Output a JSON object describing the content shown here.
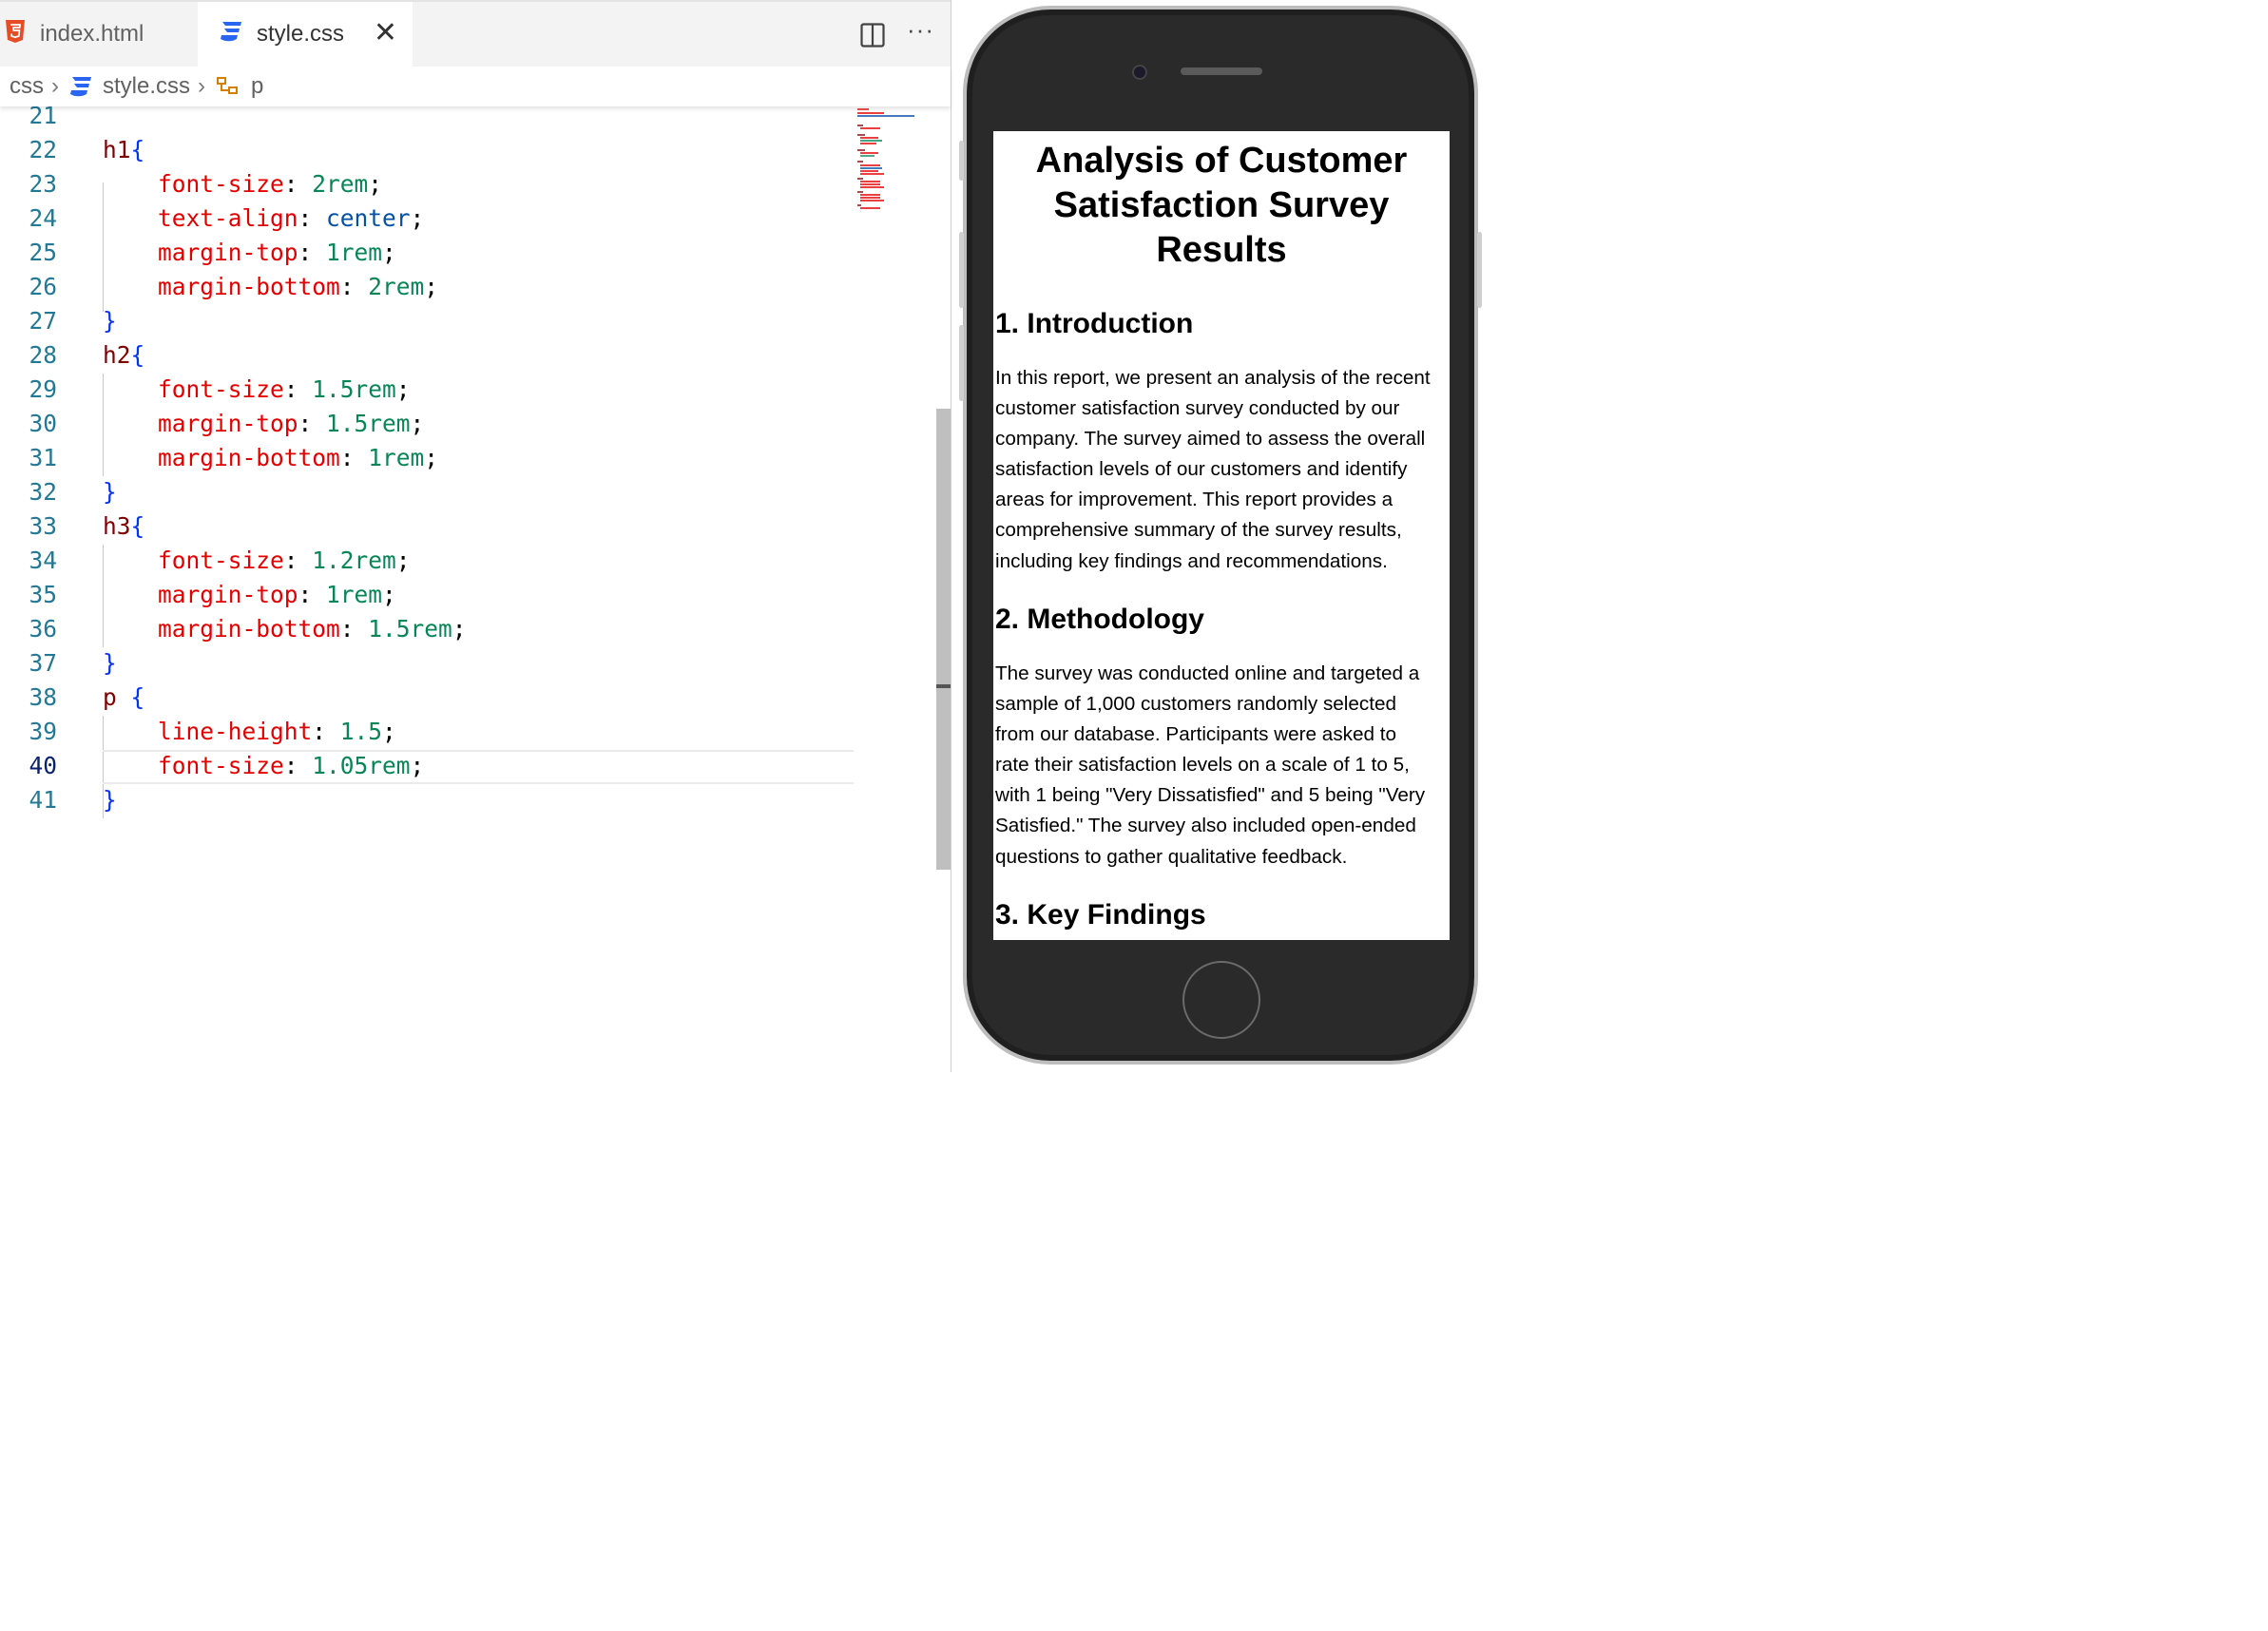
{
  "editor": {
    "tabs": [
      {
        "label": "index.html",
        "icon": "html5-icon"
      },
      {
        "label": "style.css",
        "icon": "css3-icon",
        "active": true
      }
    ],
    "close_glyph": "✕",
    "more_glyph": "···",
    "breadcrumb": [
      "css",
      "style.css",
      "p"
    ],
    "line_numbers": [
      "21",
      "22",
      "23",
      "24",
      "25",
      "26",
      "27",
      "28",
      "29",
      "30",
      "31",
      "32",
      "33",
      "34",
      "35",
      "36",
      "37",
      "38",
      "39",
      "40",
      "41"
    ],
    "active_line": "40",
    "code": {
      "h1_sel": "h1",
      "open": "{",
      "close": "}",
      "h1_fs_prop": "font-size",
      "h1_fs_val": "2rem",
      "h1_ta_prop": "text-align",
      "h1_ta_val": "center",
      "h1_mt_prop": "margin-top",
      "h1_mt_val": "1rem",
      "h1_mb_prop": "margin-bottom",
      "h1_mb_val": "2rem",
      "h2_sel": "h2",
      "h2_fs_prop": "font-size",
      "h2_fs_val": "1.5rem",
      "h2_mt_prop": "margin-top",
      "h2_mt_val": "1.5rem",
      "h2_mb_prop": "margin-bottom",
      "h2_mb_val": "1rem",
      "h3_sel": "h3",
      "h3_fs_prop": "font-size",
      "h3_fs_val": "1.2rem",
      "h3_mt_prop": "margin-top",
      "h3_mt_val": "1rem",
      "h3_mb_prop": "margin-bottom",
      "h3_mb_val": "1.5rem",
      "p_sel": "p",
      "p_lh_prop": "line-height",
      "p_lh_val": "1.5",
      "p_fs_prop": "font-size",
      "p_fs_val": "1.05rem",
      "colon": ": ",
      "semi": ";"
    }
  },
  "preview": {
    "title_lines": [
      "Analysis of Customer",
      "Satisfaction Survey",
      "Results"
    ],
    "sections": [
      {
        "heading": "1. Introduction",
        "lines": [
          "In this report, we present an analysis of the recent",
          "customer satisfaction survey conducted by our",
          "company. The survey aimed to assess the overall",
          "satisfaction levels of our customers and identify",
          "areas for improvement. This report provides a",
          "comprehensive summary of the survey results,",
          "including key findings and recommendations."
        ]
      },
      {
        "heading": "2. Methodology",
        "lines": [
          "The survey was conducted online and targeted a",
          "sample of 1,000 customers randomly selected",
          "from our database. Participants were asked to",
          "rate their satisfaction levels on a scale of 1 to 5,",
          "with 1 being \"Very Dissatisfied\" and 5 being \"Very",
          "Satisfied.\" The survey also included open-ended",
          "questions to gather qualitative feedback."
        ]
      },
      {
        "heading": "3. Key Findings",
        "lines": []
      }
    ]
  },
  "colors": {
    "html_icon": "#e44d26",
    "css_icon": "#2965f1",
    "selector": "#800000",
    "property": "#e50000",
    "number": "#098658",
    "keyword": "#0451a5",
    "brace": "#0431fa",
    "line_number": "#237893"
  }
}
